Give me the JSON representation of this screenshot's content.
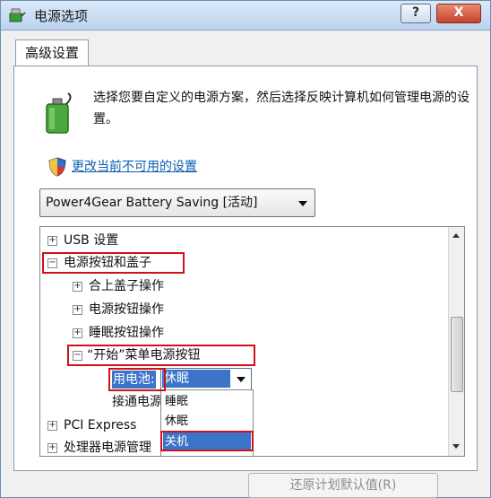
{
  "window": {
    "title": "电源选项",
    "help_label": "?",
    "close_label": "X"
  },
  "tab": {
    "label": "高级设置"
  },
  "description": "选择您要自定义的电源方案，然后选择反映计算机如何管理电源的设置。",
  "change_link": "更改当前不可用的设置",
  "plan": {
    "selected": "Power4Gear Battery Saving [活动]"
  },
  "tree": {
    "items": [
      {
        "label": "USB 设置",
        "expander": "+"
      },
      {
        "label": "电源按钮和盖子",
        "expander": "−"
      },
      {
        "label": "合上盖子操作",
        "expander": "+"
      },
      {
        "label": "电源按钮操作",
        "expander": "+"
      },
      {
        "label": "睡眠按钮操作",
        "expander": "+"
      },
      {
        "label": "“开始”菜单电源按钮",
        "expander": "−"
      },
      {
        "label": "用电池:"
      },
      {
        "label": "接通电源"
      },
      {
        "label": "PCI Express",
        "expander": "+"
      },
      {
        "label": "处理器电源管理",
        "expander": "+"
      }
    ]
  },
  "battery_dropdown": {
    "selected": "休眠",
    "options": [
      "睡眠",
      "休眠",
      "关机"
    ],
    "highlighted": "关机"
  },
  "restore_button": "还原计划默认值(R)"
}
